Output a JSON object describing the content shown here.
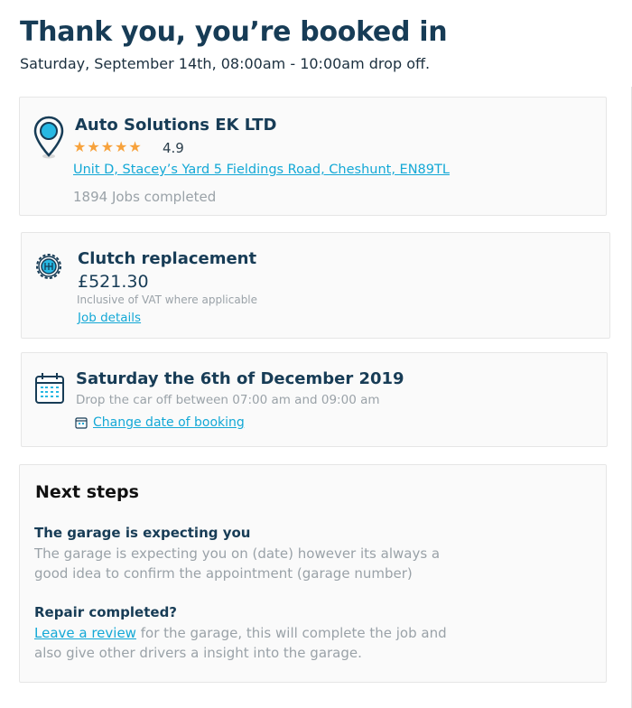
{
  "header": {
    "title": "Thank you, you’re booked in",
    "subtitle": "Saturday, September 14th, 08:00am - 10:00am drop off."
  },
  "garage": {
    "name": "Auto Solutions EK LTD",
    "stars": "★★★★★",
    "rating": "4.9",
    "address": "Unit D, Stacey’s Yard 5 Fieldings Road, Cheshunt, EN89TL",
    "jobs_completed": "1894 Jobs completed",
    "icon": "location-pin-icon"
  },
  "job": {
    "name": "Clutch replacement",
    "price": "£521.30",
    "vat_note": "Inclusive of VAT where applicable",
    "details_link": "Job details",
    "icon": "gear-shift-icon"
  },
  "booking": {
    "date": "Saturday the 6th of December 2019",
    "dropoff": "Drop the car off between 07:00 am and 09:00 am",
    "change_link": "Change date of booking",
    "icon": "calendar-icon"
  },
  "next_steps": {
    "heading": "Next steps",
    "expecting": {
      "title": "The garage is expecting you",
      "text": "The garage is expecting you on (date) however its always a good idea to confirm the appointment (garage number)"
    },
    "repair": {
      "title": "Repair completed?",
      "link": "Leave a review",
      "text": " for the garage, this will complete the job and also give other drivers a insight into the garage."
    }
  },
  "colors": {
    "primary": "#173c56",
    "link": "#13a8d6",
    "star": "#f7a23c",
    "muted": "#9aa2a8",
    "card_bg": "#fafafa"
  }
}
